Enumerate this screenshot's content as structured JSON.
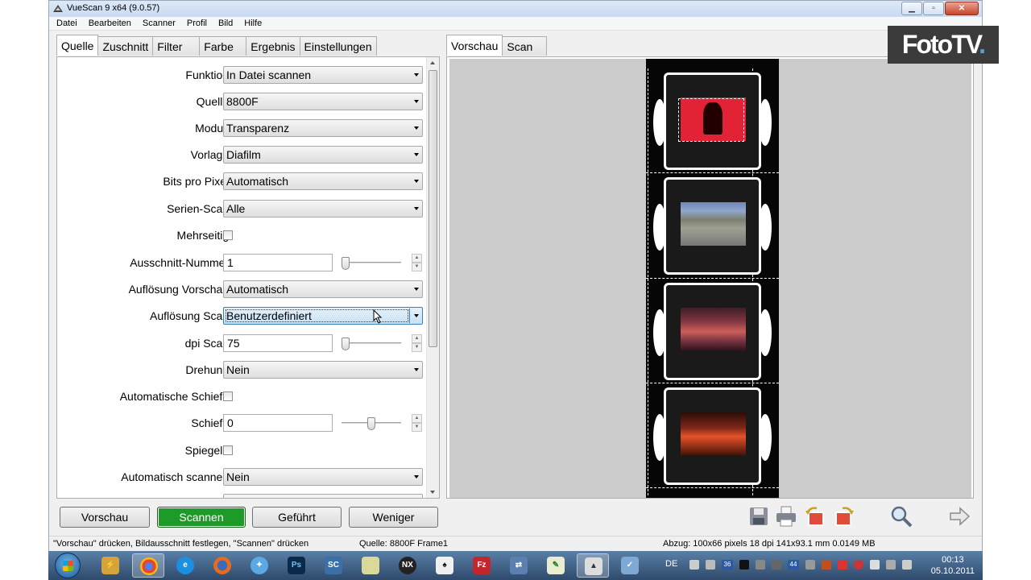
{
  "window": {
    "title": "VueScan 9 x64 (9.0.57)"
  },
  "menu": [
    "Datei",
    "Bearbeiten",
    "Scanner",
    "Profil",
    "Bild",
    "Hilfe"
  ],
  "left_tabs": [
    "Quelle",
    "Zuschnitt",
    "Filter",
    "Farbe",
    "Ergebnis",
    "Einstellungen"
  ],
  "right_tabs": [
    "Vorschau",
    "Scan"
  ],
  "form": {
    "funktion": {
      "label": "Funktion:",
      "value": "In Datei scannen"
    },
    "quelle": {
      "label": "Quelle:",
      "value": "8800F"
    },
    "modus": {
      "label": "Modus:",
      "value": "Transparenz"
    },
    "vorlage": {
      "label": "Vorlage:",
      "value": "Diafilm"
    },
    "bits": {
      "label": "Bits pro Pixel:",
      "value": "Automatisch"
    },
    "serien": {
      "label": "Serien-Scan:",
      "value": "Alle"
    },
    "mehrseitig": {
      "label": "Mehrseitig:",
      "checked": false
    },
    "ausschnitt": {
      "label": "Ausschnitt-Nummer:",
      "value": "1"
    },
    "aufl_vorschau": {
      "label": "Auflösung Vorschau:",
      "value": "Automatisch"
    },
    "aufl_scan": {
      "label": "Auflösung Scan:",
      "value": "Benutzerdefiniert"
    },
    "dpi": {
      "label": "dpi Scan:",
      "value": "75"
    },
    "drehung": {
      "label": "Drehung:",
      "value": "Nein"
    },
    "auto_schiefe": {
      "label": "Automatische Schiefe:",
      "checked": false
    },
    "schiefe": {
      "label": "Schiefe:",
      "value": "0"
    },
    "spiegeln": {
      "label": "Spiegeln:",
      "checked": false
    },
    "auto_scannen": {
      "label": "Automatisch scannen:",
      "value": "Nein"
    }
  },
  "buttons": {
    "vorschau": "Vorschau",
    "scannen": "Scannen",
    "gefuehrt": "Geführt",
    "weniger": "Weniger"
  },
  "toolbar_icons": [
    "save-icon",
    "print-icon",
    "rotate-left-icon",
    "rotate-right-icon",
    "zoom-icon",
    "next-arrow-icon"
  ],
  "status": {
    "hint": "\"Vorschau\" drücken, Bildausschnitt festlegen, \"Scannen\" drücken",
    "source": "Quelle: 8800F Frame1",
    "output": "Abzug: 100x66 pixels 18 dpi 141x93.1 mm 0.0149 MB"
  },
  "taskbar": {
    "apps": [
      "explorer",
      "chrome",
      "internet-explorer",
      "firefox",
      "safari",
      "Ps",
      "SC",
      "notes",
      "NX2",
      "solitaire",
      "Fz",
      "network",
      "notepad",
      "vuescan",
      "settings"
    ],
    "tray": {
      "lang": "DE",
      "badge_a": "36",
      "badge_b": "44"
    },
    "time": "00:13",
    "date": "05.10.2011"
  },
  "watermark": {
    "text": "FotoTV",
    "dot": "."
  },
  "colors": {
    "scan_button": "#1e9a28",
    "photo1": "#e22336",
    "titlebar": "#c9dbef"
  }
}
